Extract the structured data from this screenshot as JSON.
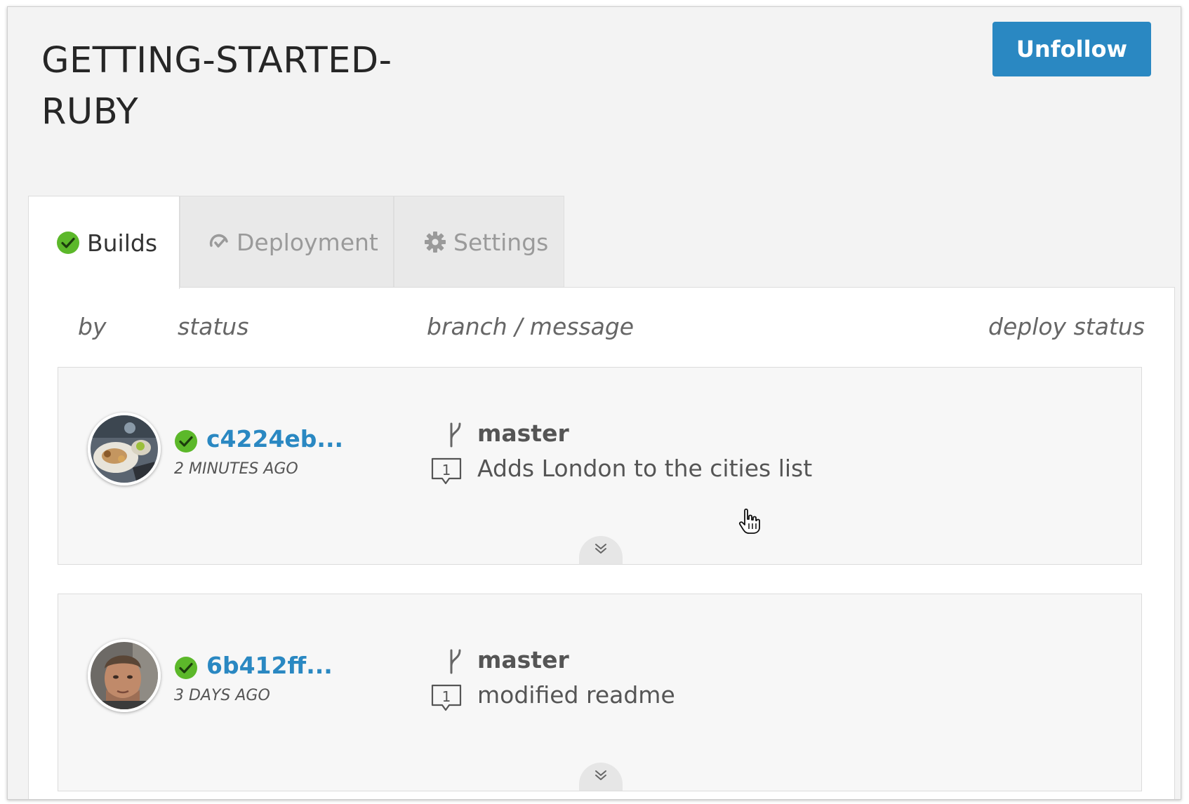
{
  "header": {
    "title": "GETTING-STARTED-RUBY",
    "unfollow_label": "Unfollow"
  },
  "tabs": [
    {
      "label": "Builds",
      "icon": "green-check-icon",
      "active": true
    },
    {
      "label": "Deployment",
      "icon": "deploy-icon",
      "active": false
    },
    {
      "label": "Settings",
      "icon": "gear-icon",
      "active": false
    }
  ],
  "columns": {
    "by": "by",
    "status": "status",
    "branch_message": "branch / message",
    "deploy_status": "deploy status"
  },
  "builds": [
    {
      "commit": "c4224eb...",
      "time": "2 MINUTES AGO",
      "branch": "master",
      "comments": "1",
      "message": "Adds London to the cities list",
      "status": "passed"
    },
    {
      "commit": "6b412ff...",
      "time": "3 DAYS AGO",
      "branch": "master",
      "comments": "1",
      "message": "modified readme",
      "status": "passed"
    }
  ],
  "colors": {
    "accent": "#2a88c2",
    "success": "#5cb82a"
  }
}
